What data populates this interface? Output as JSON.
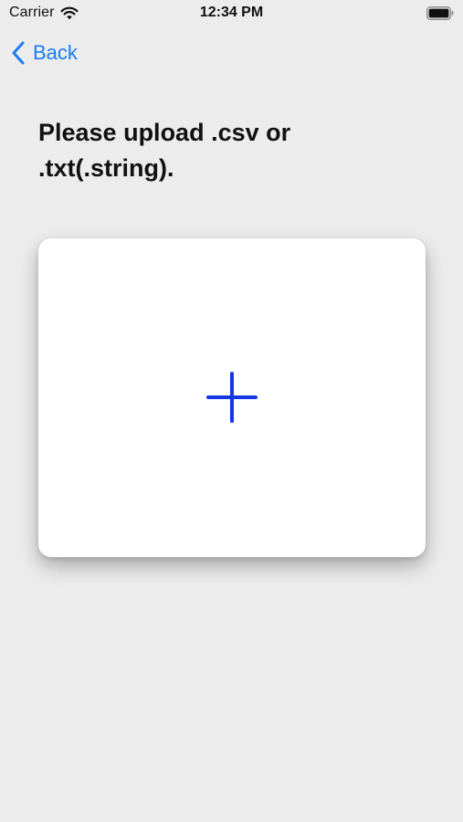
{
  "status_bar": {
    "carrier": "Carrier",
    "time": "12:34 PM",
    "wifi_icon": "wifi-icon",
    "battery_icon": "battery-full-icon"
  },
  "nav": {
    "back_label": "Back",
    "back_icon": "chevron-left-icon"
  },
  "main": {
    "title": "Please upload .csv or .txt(.string).",
    "upload_icon": "plus-icon"
  },
  "colors": {
    "background": "#ececec",
    "accent": "#1a7cf2",
    "plus": "#1536e6",
    "card": "#ffffff"
  }
}
